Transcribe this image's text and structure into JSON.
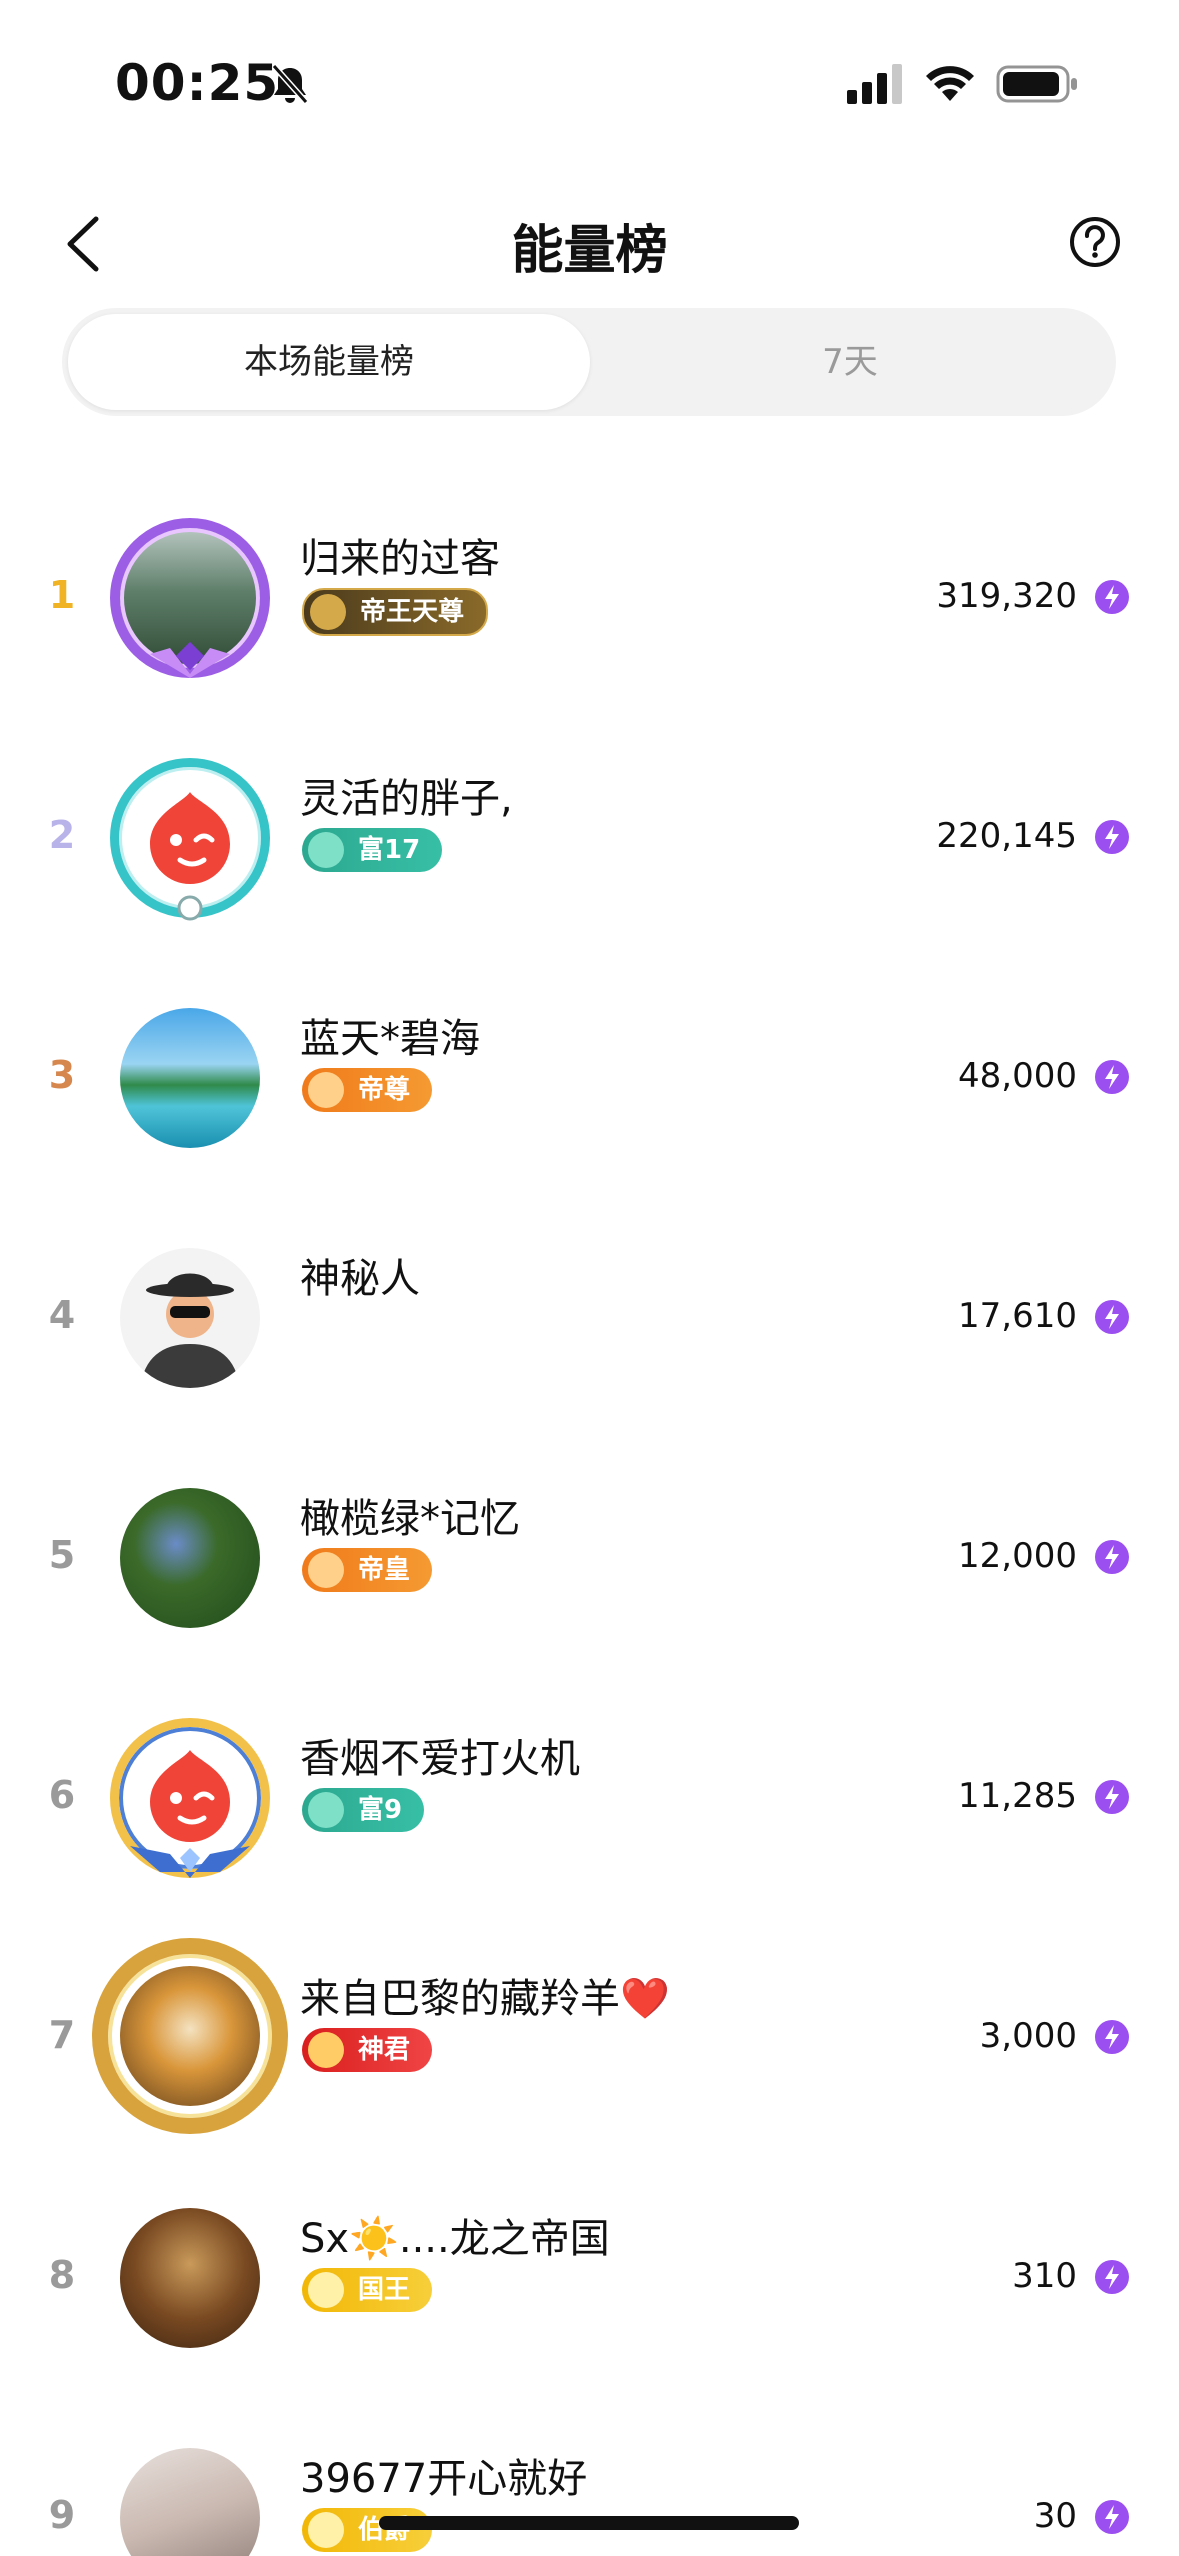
{
  "status_bar": {
    "time": "00:25"
  },
  "header": {
    "title": "能量榜"
  },
  "tabs": [
    {
      "label": "本场能量榜"
    },
    {
      "label": "7天"
    }
  ],
  "rows": [
    {
      "rank": "1",
      "name": "归来的过客",
      "badge": "帝王天尊",
      "score": "319,320"
    },
    {
      "rank": "2",
      "name": "灵活的胖子,",
      "badge": "富17",
      "score": "220,145"
    },
    {
      "rank": "3",
      "name": "蓝天*碧海",
      "badge": "帝尊",
      "score": "48,000"
    },
    {
      "rank": "4",
      "name": "神秘人",
      "badge": "",
      "score": "17,610"
    },
    {
      "rank": "5",
      "name": "橄榄绿*记忆",
      "badge": "帝皇",
      "score": "12,000"
    },
    {
      "rank": "6",
      "name": "香烟不爱打火机",
      "badge": "富9",
      "score": "11,285"
    },
    {
      "rank": "7",
      "name": "来自巴黎的藏羚羊❤️",
      "badge": "神君",
      "score": "3,000"
    },
    {
      "rank": "8",
      "name": "Sx☀️....龙之帝国",
      "badge": "国王",
      "score": "310"
    },
    {
      "rank": "9",
      "name": "39677开心就好",
      "badge": "伯爵",
      "score": "30"
    }
  ]
}
